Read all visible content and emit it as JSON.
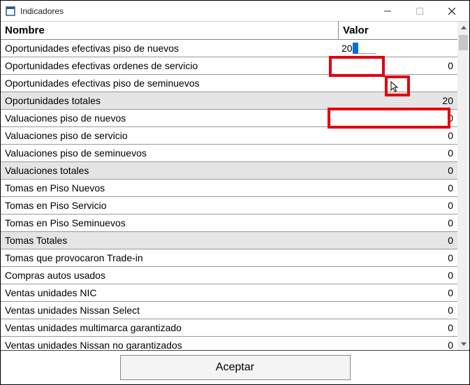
{
  "window": {
    "title": "Indicadores"
  },
  "headers": {
    "name": "Nombre",
    "value": "Valor"
  },
  "rows": [
    {
      "label": "Oportunidades efectivas piso de nuevos",
      "value": "20",
      "editing": true
    },
    {
      "label": "Oportunidades efectivas ordenes de servicio",
      "value": "0"
    },
    {
      "label": "Oportunidades efectivas piso de seminuevos",
      "value": ""
    },
    {
      "label": "Oportunidades totales",
      "value": "20",
      "total": true
    },
    {
      "label": "Valuaciones piso de nuevos",
      "value": "0"
    },
    {
      "label": "Valuaciones piso de servicio",
      "value": "0"
    },
    {
      "label": "Valuaciones piso de seminuevos",
      "value": "0"
    },
    {
      "label": "Valuaciones totales",
      "value": "0",
      "total": true
    },
    {
      "label": "Tomas en Piso Nuevos",
      "value": "0"
    },
    {
      "label": "Tomas en Piso Servicio",
      "value": "0"
    },
    {
      "label": "Tomas en Piso Seminuevos",
      "value": "0"
    },
    {
      "label": "Tomas Totales",
      "value": "0",
      "total": true
    },
    {
      "label": "Tomas que provocaron Trade-in",
      "value": "0"
    },
    {
      "label": "Compras autos usados",
      "value": "0"
    },
    {
      "label": "Ventas unidades NIC",
      "value": "0"
    },
    {
      "label": "Ventas unidades Nissan Select",
      "value": "0"
    },
    {
      "label": "Ventas unidades multimarca garantizado",
      "value": "0"
    },
    {
      "label": "Ventas unidades Nissan no garantizados",
      "value": "0"
    }
  ],
  "footer": {
    "accept": "Aceptar"
  },
  "editing_placeholder": "___"
}
